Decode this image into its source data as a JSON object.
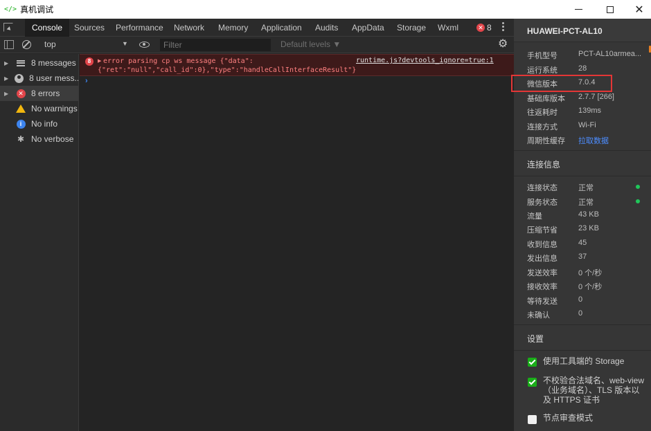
{
  "window": {
    "icon": "</>",
    "title": "真机调试",
    "close_glyph": "✕"
  },
  "tabs": [
    "Console",
    "Sources",
    "Performance",
    "Network",
    "Memory",
    "Application",
    "Audits",
    "AppData",
    "Storage",
    "Wxml"
  ],
  "error_badge": {
    "icon": "✕",
    "count": "8"
  },
  "toolbar": {
    "context": "top",
    "filter_placeholder": "Filter",
    "levels": "Default levels ▼"
  },
  "sidebar": {
    "items": [
      {
        "label": "8 messages",
        "icon": "list-icon"
      },
      {
        "label": "8 user mess...",
        "icon": "user-icon"
      },
      {
        "label": "8 errors",
        "icon": "error-icon"
      },
      {
        "label": "No warnings",
        "icon": "warning-icon"
      },
      {
        "label": "No info",
        "icon": "info-icon"
      },
      {
        "label": "No verbose",
        "icon": "bug-icon"
      }
    ]
  },
  "console": {
    "error": {
      "count": "8",
      "line1": "error parsing cp ws message {\"data\":",
      "line2": "{\"ret\":\"null\",\"call_id\":0},\"type\":\"handleCallInterfaceResult\"}",
      "source": "runtime.js?devtools_ignore=true:1"
    },
    "prompt": "›"
  },
  "device": {
    "name": "HUAWEI-PCT-AL10",
    "info": [
      {
        "label": "手机型号",
        "value": "PCT-AL10armea..."
      },
      {
        "label": "运行系统",
        "value": "28"
      },
      {
        "label": "微信版本",
        "value": "7.0.4"
      },
      {
        "label": "基础库版本",
        "value": "2.7.7 [266]"
      },
      {
        "label": "往返耗时",
        "value": "139ms"
      },
      {
        "label": "连接方式",
        "value": "Wi-Fi"
      },
      {
        "label": "周期性缓存",
        "value": "拉取数据"
      }
    ],
    "connection_title": "连接信息",
    "connection": [
      {
        "label": "连接状态",
        "value": "正常"
      },
      {
        "label": "服务状态",
        "value": "正常"
      },
      {
        "label": "流量",
        "value": "43 KB"
      },
      {
        "label": "压缩节省",
        "value": "23 KB"
      },
      {
        "label": "收到信息",
        "value": "45"
      },
      {
        "label": "发出信息",
        "value": "37"
      },
      {
        "label": "发送效率",
        "value": "0 个/秒"
      },
      {
        "label": "接收效率",
        "value": "0 个/秒"
      },
      {
        "label": "等待发送",
        "value": "0"
      },
      {
        "label": "未确认",
        "value": "0"
      }
    ],
    "settings_title": "设置",
    "settings": [
      {
        "label": "使用工具端的 Storage",
        "checked": true
      },
      {
        "label": "不校验合法域名、web-view（业务域名）、TLS 版本以及 HTTPS 证书",
        "checked": true
      },
      {
        "label": "节点审查模式",
        "checked": false
      }
    ]
  },
  "colors": {
    "accent_green": "#1aad19",
    "error_red": "#e2454a",
    "link_blue": "#4d8dff",
    "highlight_red": "#e43636"
  }
}
